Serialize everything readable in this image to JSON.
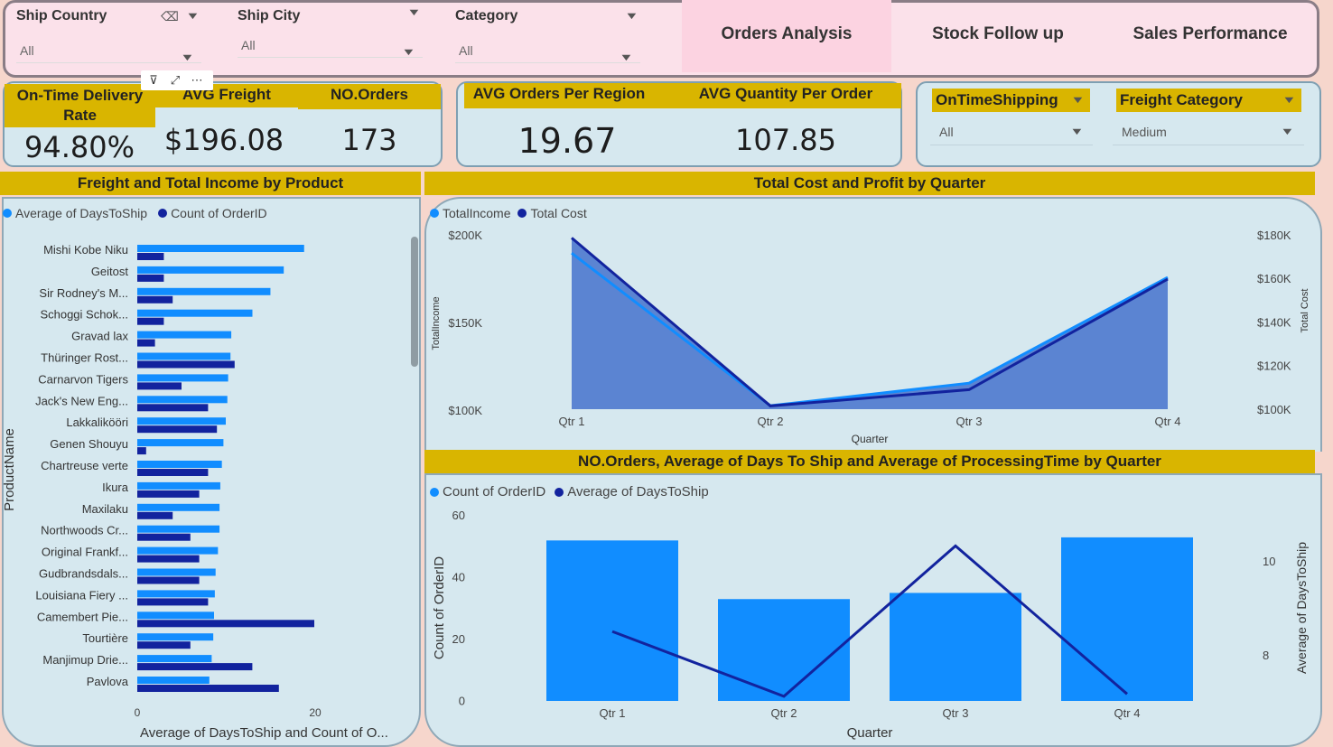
{
  "filters": {
    "ship_country": {
      "title": "Ship Country",
      "value": "All"
    },
    "ship_city": {
      "title": "Ship City",
      "value": "All"
    },
    "category": {
      "title": "Category",
      "value": "All"
    }
  },
  "nav": {
    "orders_analysis": "Orders Analysis",
    "stock_follow_up": "Stock Follow up",
    "sales_performance": "Sales Performance"
  },
  "visual_tools": {
    "filter": "⊽",
    "focus": "⤢",
    "more": "⋯"
  },
  "kpis": {
    "on_time_label": "On-Time Delivery Rate",
    "on_time_value": "94.80%",
    "avg_freight_label": "AVG Freight",
    "avg_freight_value": "$196.08",
    "no_orders_label": "NO.Orders",
    "no_orders_value": "173",
    "avg_orders_region_label": "AVG Orders Per Region",
    "avg_orders_region_value": "19.67",
    "avg_qty_order_label": "AVG Quantity Per Order",
    "avg_qty_order_value": "107.85"
  },
  "slicers": {
    "on_time_shipping": {
      "title": "OnTimeShipping",
      "value": "All"
    },
    "freight_category": {
      "title": "Freight Category",
      "value": "Medium"
    }
  },
  "headers": {
    "left": "Freight and Total Income by Product",
    "top_right": "Total Cost and Profit by Quarter",
    "bottom_right": "NO.Orders, Average of Days To Ship and Average of ProcessingTime by Quarter"
  },
  "colors": {
    "light": "#118dff",
    "dark": "#12239e",
    "gold": "#d9b500",
    "area": "#5b84d2"
  },
  "chart_data": [
    {
      "type": "bar",
      "orientation": "horizontal",
      "legend": [
        "Average of DaysToShip",
        "Count of OrderID"
      ],
      "ylabel": "ProductName",
      "xlabel": "Average of DaysToShip and Count of O...",
      "xticks": [
        "0",
        "20"
      ],
      "xlim": [
        0,
        30
      ],
      "categories": [
        "Mishi Kobe Niku",
        "Geitost",
        "Sir Rodney's M...",
        "Schoggi Schok...",
        "Gravad lax",
        "Thüringer Rost...",
        "Carnarvon Tigers",
        "Jack's New Eng...",
        "Lakkalikööri",
        "Genen Shouyu",
        "Chartreuse verte",
        "Ikura",
        "Maxilaku",
        "Northwoods Cr...",
        "Original Frankf...",
        "Gudbrandsdals...",
        "Louisiana Fiery ...",
        "Camembert Pie...",
        "Tourtière",
        "Manjimup Drie...",
        "Pavlova"
      ],
      "series": [
        {
          "name": "Average of DaysToShip",
          "values": [
            21.3,
            18.7,
            17.0,
            14.7,
            12.0,
            11.9,
            11.6,
            11.5,
            11.3,
            11.0,
            10.8,
            10.6,
            10.5,
            10.5,
            10.3,
            10.0,
            9.9,
            9.8,
            9.7,
            9.5,
            9.2
          ]
        },
        {
          "name": "Count of OrderID",
          "values": [
            3,
            3,
            4,
            3,
            2,
            11,
            5,
            8,
            9,
            1,
            8,
            7,
            4,
            6,
            7,
            7,
            8,
            20,
            6,
            13,
            16
          ]
        }
      ]
    },
    {
      "type": "area",
      "legend": [
        "TotalIncome",
        "Total Cost"
      ],
      "categories": [
        "Qtr 1",
        "Qtr 2",
        "Qtr 3",
        "Qtr 4"
      ],
      "xlabel": "Quarter",
      "ylabel": "TotalIncome",
      "y2label": "Total Cost",
      "yticks": [
        "$200K",
        "$150K",
        "$100K"
      ],
      "y2ticks": [
        "$180K",
        "$160K",
        "$140K",
        "$120K",
        "$100K"
      ],
      "ylim": [
        100000,
        200000
      ],
      "y2lim": [
        100000,
        180000
      ],
      "series": [
        {
          "name": "TotalIncome",
          "axis": "left",
          "values": [
            190000,
            102000,
            115000,
            176000
          ]
        },
        {
          "name": "Total Cost",
          "axis": "right",
          "values": [
            179000,
            101500,
            109000,
            160000
          ]
        }
      ]
    },
    {
      "type": "bar",
      "legend": [
        "Count of OrderID",
        "Average of DaysToShip"
      ],
      "categories": [
        "Qtr 1",
        "Qtr 2",
        "Qtr 3",
        "Qtr 4"
      ],
      "xlabel": "Quarter",
      "ylabel": "Count of OrderID",
      "y2label": "Average of DaysToShip",
      "yticks": [
        "60",
        "40",
        "20",
        "0"
      ],
      "y2ticks": [
        "10",
        "8"
      ],
      "ylim": [
        0,
        60
      ],
      "y2lim": [
        7.0,
        11.0
      ],
      "series": [
        {
          "name": "Count of OrderID",
          "type": "bar",
          "values": [
            52,
            33,
            35,
            53
          ]
        },
        {
          "name": "Average of DaysToShip",
          "type": "line",
          "axis": "right",
          "values": [
            8.5,
            7.1,
            10.35,
            7.15
          ]
        }
      ]
    }
  ]
}
